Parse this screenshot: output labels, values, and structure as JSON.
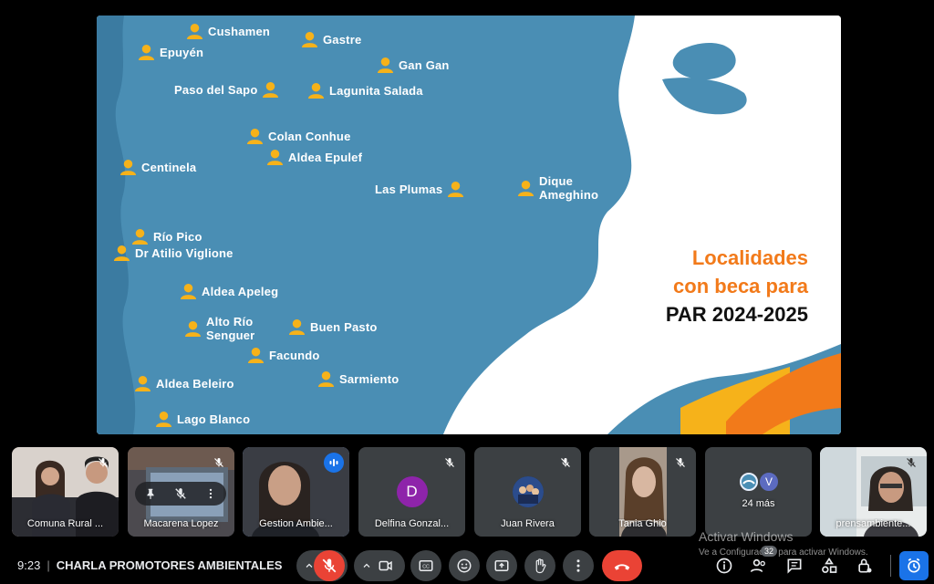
{
  "slide": {
    "title_line1": "Localidades",
    "title_line2": "con beca para",
    "title_line3": "PAR 2024-2025",
    "colors": {
      "sea": "#4a8eb4",
      "land": "#ffffff",
      "pin": "#f6b21a",
      "accent_orange": "#f27a1a",
      "accent_yellow": "#f6b21a",
      "accent_blue": "#4a8eb4"
    },
    "places": [
      "Cushamen",
      "Gastre",
      "Epuyén",
      "Gan Gan",
      "Paso del Sapo",
      "Lagunita Salada",
      "Colan Conhue",
      "Aldea Epulef",
      "Centinela",
      "Las Plumas",
      "Dique Ameghino",
      "Río Pico",
      "Dr Atilio Viglione",
      "Aldea Apeleg",
      "Alto Río Senguer",
      "Buen Pasto",
      "Facundo",
      "Sarmiento",
      "Aldea Beleiro",
      "Lago Blanco"
    ]
  },
  "participants": [
    {
      "name": "Comuna Rural ...",
      "muted": true
    },
    {
      "name": "Macarena Lopez",
      "muted": true
    },
    {
      "name": "Gestion Ambie...",
      "speaking": true
    },
    {
      "name": "Delfina Gonzal...",
      "initial": "D",
      "avatar_color": "#8e24aa",
      "muted": true
    },
    {
      "name": "Juan Rivera",
      "muted": true
    },
    {
      "name": "Tania Ghio",
      "muted": true
    },
    {
      "name": "24 más",
      "extra_initial": "V",
      "extra_color": "#5c6bc0"
    },
    {
      "name": "prensambiente...",
      "muted": true
    }
  ],
  "meeting": {
    "time": "9:23",
    "separator": "|",
    "title": "CHARLA PROMOTORES AMBIENTALES",
    "participants_count": "32"
  },
  "watermark": {
    "line1": "Activar Windows",
    "line2": "Ve a Configuración para activar Windows."
  },
  "icons": [
    "mic-off-icon",
    "camera-icon",
    "captions-icon",
    "emoji-icon",
    "present-icon",
    "raise-hand-icon",
    "more-options-icon",
    "end-call-icon",
    "info-icon",
    "people-icon",
    "chat-icon",
    "activities-icon",
    "host-controls-icon",
    "timer-icon",
    "pin-icon"
  ]
}
